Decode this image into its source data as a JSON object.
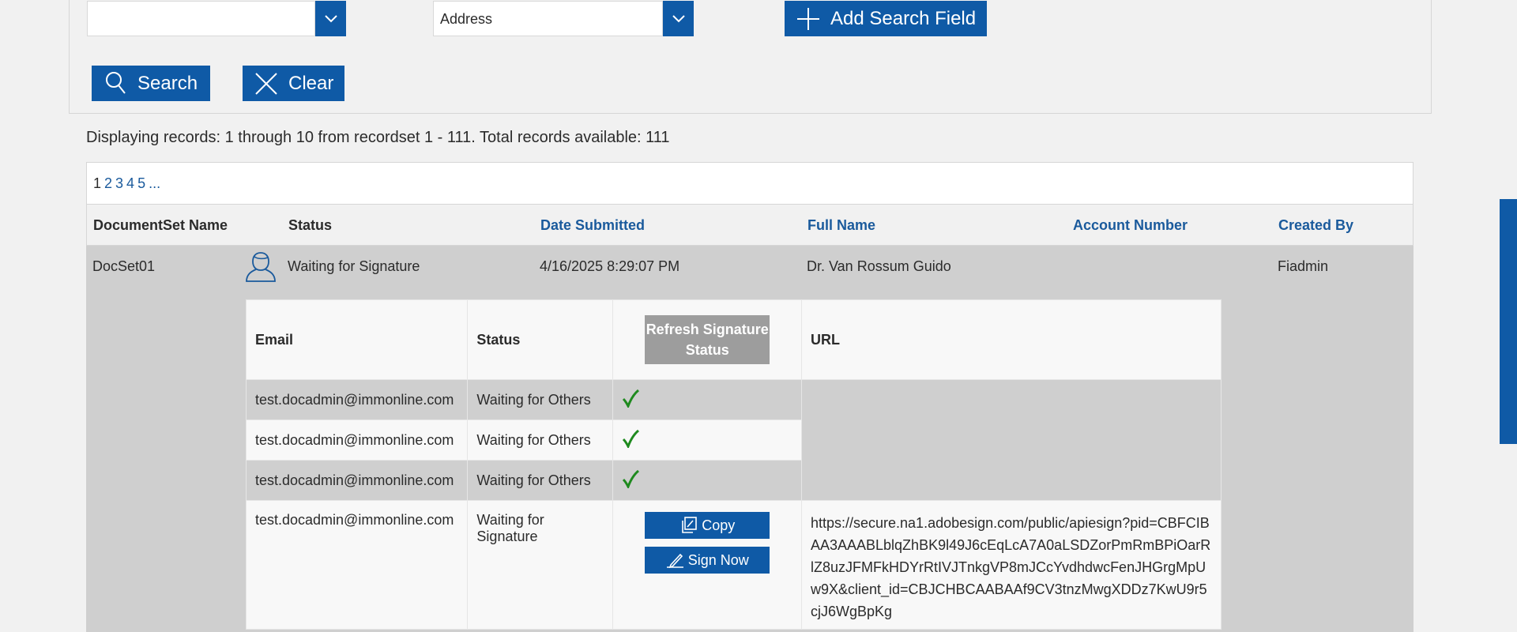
{
  "search": {
    "field1_value": "",
    "field2_value": "Address",
    "add_field_label": "Add Search Field",
    "search_label": "Search",
    "clear_label": "Clear"
  },
  "summary": "Displaying records: 1 through 10 from recordset 1 - 111. Total records available: 111",
  "pager": {
    "pages": [
      "1",
      "2",
      "3",
      "4",
      "5",
      "..."
    ]
  },
  "grid": {
    "headers": {
      "docset_name": "DocumentSet Name",
      "status": "Status",
      "date_submitted": "Date Submitted",
      "full_name": "Full Name",
      "account_number": "Account Number",
      "created_by": "Created By"
    },
    "row": {
      "docset_name": "DocSet01",
      "status": "Waiting for Signature",
      "date_submitted": "4/16/2025 8:29:07 PM",
      "full_name": "Dr. Van Rossum Guido",
      "account_number": "",
      "created_by": "Fiadmin"
    }
  },
  "signers": {
    "headers": {
      "email": "Email",
      "status": "Status",
      "refresh_label": "Refresh Signature Status",
      "url": "URL"
    },
    "rows": [
      {
        "email": "test.docadmin@immonline.com",
        "status": "Waiting for Others"
      },
      {
        "email": "test.docadmin@immonline.com",
        "status": "Waiting for Others"
      },
      {
        "email": "test.docadmin@immonline.com",
        "status": "Waiting for Others"
      },
      {
        "email": "test.docadmin@immonline.com",
        "status": "Waiting for Signature"
      }
    ],
    "copy_label": "Copy",
    "sign_now_label": "Sign Now",
    "url": "https://secure.na1.adobesign.com/public/apiesign?pid=CBFCIBAA3AAABLblqZhBK9l49J6cEqLcA7A0aLSDZorPmRmBPiOarRlZ8uzJFMFkHDYrRtIVJTnkgVP8mJCcYvdhdwcFenJHGrgMpUw9X&client_id=CBJCHBCAABAAf9CV3tnzMwgXDDz7KwU9r5cjJ6WgBpKg"
  },
  "colors": {
    "accent": "#0f5aa6",
    "check": "#1f8a1f",
    "link": "#1a5a9c"
  }
}
